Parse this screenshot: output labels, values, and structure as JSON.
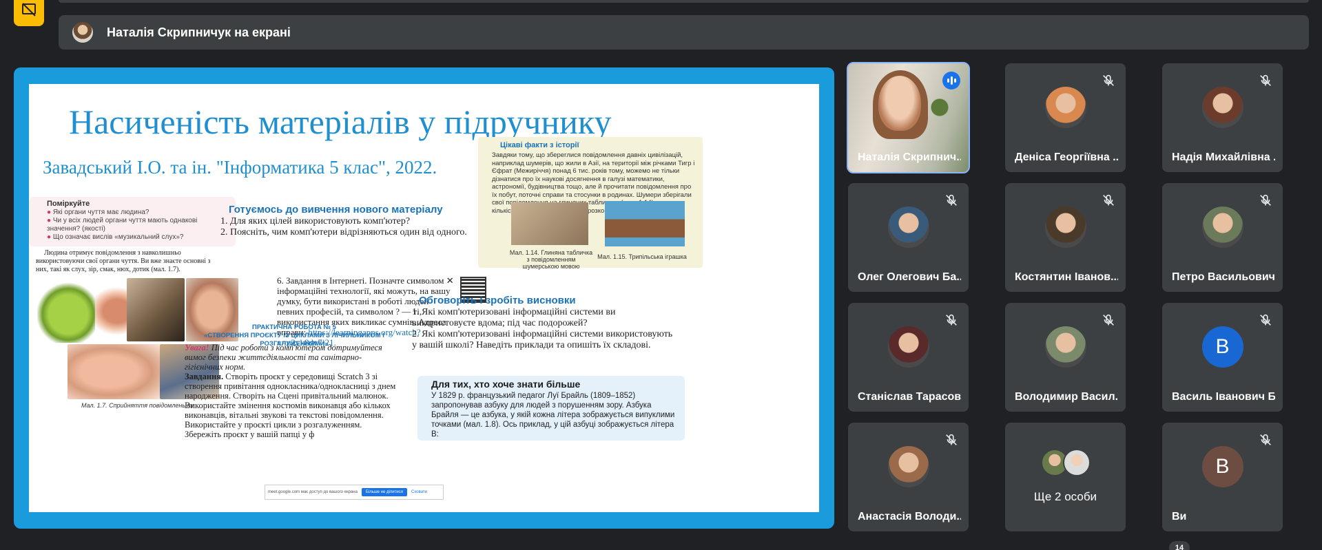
{
  "presenting": {
    "label": "Наталія Скрипничук на екрані"
  },
  "slide": {
    "title": "Насиченість матеріалів у підручнику",
    "subtitle": "Завадський І.О. та ін. \"Інформатика 5 клас\", 2022.",
    "think": {
      "title": "Поміркуйте",
      "items": [
        "Які органи чуття має людина?",
        "Чи у всіх людей органи чуття мають однакові значення? (якості)",
        "Що означає вислів «музикальний слух»?"
      ]
    },
    "intro_text": "Людина отримує повідомлення з навколишньо використовуючи свої органи чуття. Ви вже знаєте основні з них, такі як слух, зір, смак, нюх, дотик (мал. 1.7).",
    "fig17_caption": "Мал. 1.7. Сприйняття повідомлень пк",
    "prep": {
      "title": "Готуємось до вивчення нового матеріалу",
      "q1": "1. Для яких цілей використовують комп'ютер?",
      "q2": "2. Поясніть, чим комп'ютери відрізняються один від одного."
    },
    "task6": {
      "text": "6. Завдання в Інтернеті. Позначте символом ✕ інформаційні технології, які можуть, на вашу думку, бути використані в роботі людей певних професій, та символом ? — ті, використання яких викликає сумнів. Адреса вправи:",
      "link": "https://learningapps.org/watch?v=p2yk8dv7j21."
    },
    "facts": {
      "title": "Цікаві факти з історії",
      "body": "Завдяки тому, що збереглися повідомлення давніх цивілізацій, наприклад шумерів, що жили в Азії, на території між річками Тигр і Єфрат (Межиріччя) понад 6 тис. років тому, можемо не тільки дізнатися про їх наукові досягнення в галузі математики, астрономії, будівництва тощо, але й прочитати повідомлення про їх побут, поточні справи та стосунки в родинах. Шумери зберігали свої повідомлення на глиняних табличках (мал. 1.14), велику кількість яких знайдено під час розкопок стародавніх міст.",
      "cap114": "Мал. 1.14. Глиняна табличка з повідомленням шумерською мовою",
      "cap115": "Мал. 1.15. Трипільська іграшка"
    },
    "discuss": {
      "title": "Обговоріть і зробіть висновки",
      "q1": "1. Які комп'ютеризовані інформаційні системи ви використовуєте вдома; під час подорожей?",
      "q2": "2. Які комп'ютеризовані інформаційні системи використовують у вашій школі? Наведіть приклади та опишіть їх складові."
    },
    "prakt": {
      "title": "ПРАКТИЧНА РОБОТА № 5",
      "subtitle": "«СТВОРЕННЯ ПРОЄКТУ ІЗ ЦИКЛАМИ З ЛІЧИЛЬНИКОМ І РОЗГАЛУЖЕННЯМИ»",
      "uvaga_label": "Увага!",
      "uvaga": "Під час роботи з комп'ютером дотримуйтеся вимог безпеки життєдіяльності та санітарно-гігієнічних норм.",
      "zavd_label": "Завдання.",
      "zavd": "Створіть проєкт у середовищі Scratch 3 зі створення привітання однокласника/однокласниці з днем народження. Створіть на Сцені привітальний малюнок. Використайте змінення костюмів виконавця або кількох виконавців, вітальні звукові та текстові повідомлення. Використайте у проєкті цикли з розгалуженням. Збережіть проєкт у вашій папці у ф"
    },
    "more": {
      "title": "Для тих, хто хоче знати більше",
      "body": "У 1829 р. французький педагог Луї Брайль (1809–1852) запропонував азбуку для людей з порушенням зору. Азбука Брайля — це азбука, у якій кожна літера зображується випуклими точками (мал. 1.8). Ось приклад, у цій азбуці зображується літера В:"
    },
    "share_notice": {
      "text": "meet.google.com має доступ до вашого екрана",
      "stop": "Більше не ділитися",
      "hide": "Сховати"
    }
  },
  "participants": [
    {
      "name": "Наталія Скрипнич...",
      "type": "video",
      "speaking": true
    },
    {
      "name": "Деніса Георгіївна ...",
      "type": "photo",
      "muted": true,
      "color": "#d9884f"
    },
    {
      "name": "Надія Михайлівна ...",
      "type": "photo",
      "muted": true,
      "color": "#6b3b2b"
    },
    {
      "name": "Олег Олегович Ба...",
      "type": "photo",
      "muted": true,
      "color": "#3a5a7a"
    },
    {
      "name": "Костянтин Іванов...",
      "type": "photo",
      "muted": true,
      "color": "#4a3a2a"
    },
    {
      "name": "Петро Васильович...",
      "type": "photo",
      "muted": true,
      "color": "#6a7a5a"
    },
    {
      "name": "Станіслав Тарасов...",
      "type": "photo",
      "muted": true,
      "color": "#5a2a2a"
    },
    {
      "name": "Володимир Васил...",
      "type": "photo",
      "muted": true,
      "color": "#7a8a6a"
    },
    {
      "name": "Василь Іванович Б...",
      "type": "letter",
      "letter": "В",
      "muted": true,
      "color": "#1967d2"
    },
    {
      "name": "Анастасія Володи...",
      "type": "photo",
      "muted": true,
      "color": "#9a6a4a"
    },
    {
      "name": "Ще 2 особи",
      "type": "more"
    },
    {
      "name": "Ви",
      "type": "letter",
      "letter": "В",
      "muted": true,
      "color": "#6d4c41"
    }
  ],
  "participant_count": "14",
  "colors": {
    "accent": "#1a9bdc",
    "background": "#202124",
    "tile": "#3c4043",
    "toggle": "#fbbc04"
  }
}
